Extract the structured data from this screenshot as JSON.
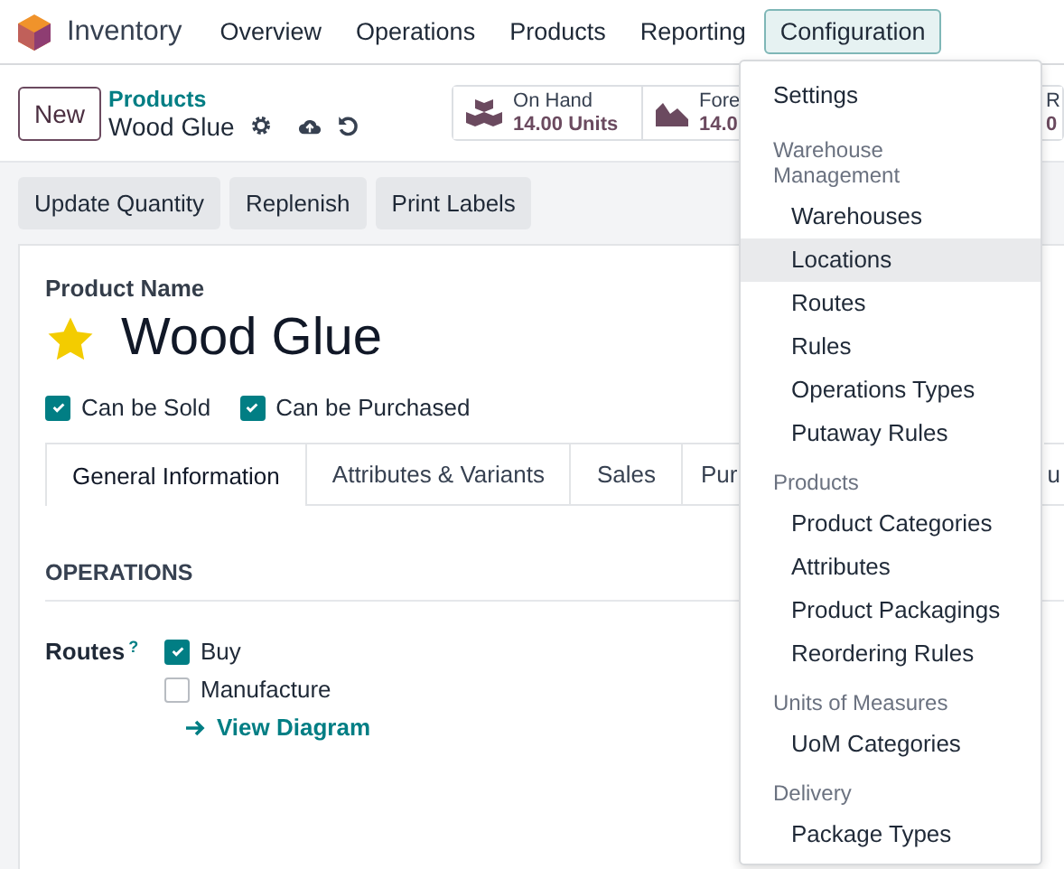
{
  "navbar": {
    "app_name": "Inventory",
    "menu": [
      {
        "label": "Overview",
        "selected": false
      },
      {
        "label": "Operations",
        "selected": false
      },
      {
        "label": "Products",
        "selected": false
      },
      {
        "label": "Reporting",
        "selected": false
      },
      {
        "label": "Configuration",
        "selected": true
      }
    ]
  },
  "control_panel": {
    "new_button": "New",
    "breadcrumb": "Products",
    "record_name": "Wood Glue",
    "stats": [
      {
        "label": "On Hand",
        "value": "14.00 Units"
      },
      {
        "label": "Fore",
        "value": "14.0"
      },
      {
        "label": "R",
        "value": "0"
      }
    ]
  },
  "actions": [
    "Update Quantity",
    "Replenish",
    "Print Labels"
  ],
  "form": {
    "name_label": "Product Name",
    "name": "Wood Glue",
    "favorite": true,
    "options": [
      {
        "label": "Can be Sold",
        "checked": true
      },
      {
        "label": "Can be Purchased",
        "checked": true
      }
    ],
    "tabs": [
      {
        "label": "General Information",
        "selected": true
      },
      {
        "label": "Attributes & Variants",
        "selected": false
      },
      {
        "label": "Sales",
        "selected": false
      },
      {
        "label": "Pur",
        "selected": false
      },
      {
        "label": "u",
        "selected": false
      }
    ],
    "section_title": "OPERATIONS",
    "routes_label": "Routes",
    "routes_help": "?",
    "routes": [
      {
        "label": "Buy",
        "checked": true
      },
      {
        "label": "Manufacture",
        "checked": false
      }
    ],
    "diagram_link": "View Diagram"
  },
  "dropdown": [
    {
      "kind": "item",
      "label": "Settings",
      "selected": false
    },
    {
      "kind": "header",
      "label": "Warehouse Management"
    },
    {
      "kind": "subitem",
      "label": "Warehouses",
      "selected": false
    },
    {
      "kind": "subitem",
      "label": "Locations",
      "selected": true
    },
    {
      "kind": "subitem",
      "label": "Routes",
      "selected": false
    },
    {
      "kind": "subitem",
      "label": "Rules",
      "selected": false
    },
    {
      "kind": "subitem",
      "label": "Operations Types",
      "selected": false
    },
    {
      "kind": "subitem",
      "label": "Putaway Rules",
      "selected": false
    },
    {
      "kind": "header",
      "label": "Products"
    },
    {
      "kind": "subitem",
      "label": "Product Categories",
      "selected": false
    },
    {
      "kind": "subitem",
      "label": "Attributes",
      "selected": false
    },
    {
      "kind": "subitem",
      "label": "Product Packagings",
      "selected": false
    },
    {
      "kind": "subitem",
      "label": "Reordering Rules",
      "selected": false
    },
    {
      "kind": "header",
      "label": "Units of Measures"
    },
    {
      "kind": "subitem",
      "label": "UoM Categories",
      "selected": false
    },
    {
      "kind": "header",
      "label": "Delivery"
    },
    {
      "kind": "subitem",
      "label": "Package Types",
      "selected": false
    }
  ]
}
